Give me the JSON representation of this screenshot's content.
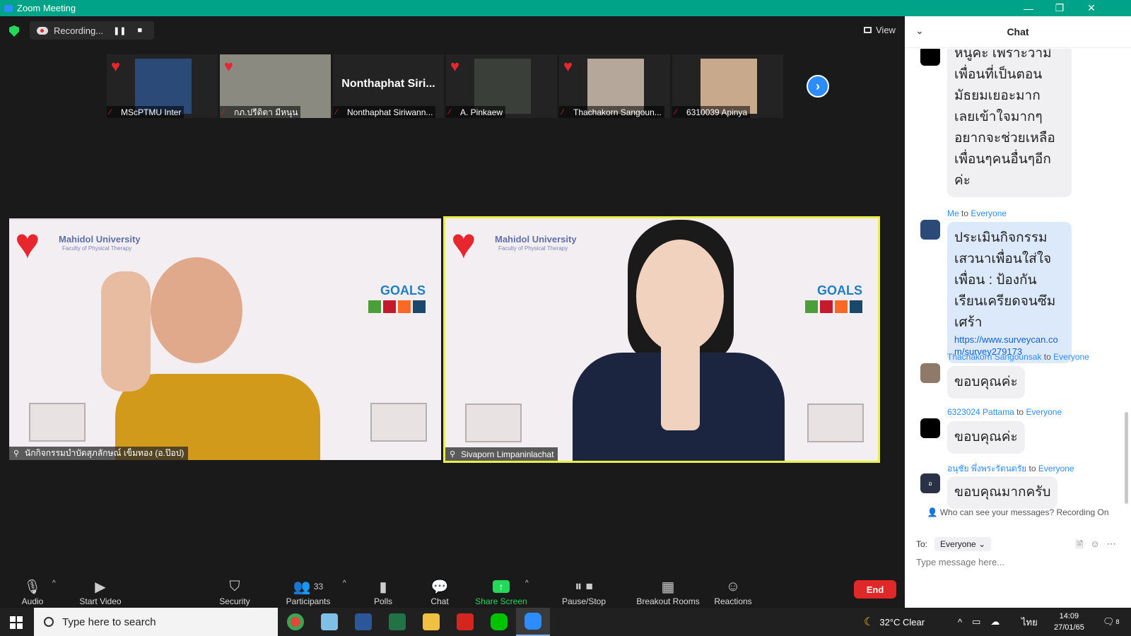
{
  "window": {
    "title": "Zoom Meeting",
    "min": "—",
    "restore": "❐",
    "close": "✕"
  },
  "meeting": {
    "recording_label": "Recording...",
    "pause_glyph": "❚❚",
    "stop_glyph": "■",
    "view_label": "View",
    "next_glyph": "›",
    "heart": "♥",
    "mic_off": "🎙"
  },
  "thumbnails": [
    {
      "name": "MScPTMU Inter",
      "pic_color": "#2b4a78"
    },
    {
      "name": "กภ.ปรีดิตา มีหนุน",
      "pic_color": "#8a8a80"
    },
    {
      "name": "Nonthaphat Siriwann...",
      "big": "Nonthaphat  Siri..."
    },
    {
      "name": "A. Pinkaew",
      "pic_color": "#3a3f3a"
    },
    {
      "name": "Thachakorn Sangoun...",
      "pic_color": "#b5a89a"
    },
    {
      "name": "6310039 Apinya",
      "pic_color": "#c9a98c"
    }
  ],
  "videos": [
    {
      "label": "นักกิจกรรมบำบัดสุภลักษณ์ เข็มทอง (อ.ป๊อป)",
      "slide_title": "Mahidol University",
      "slide_sub": "Faculty of Physical Therapy",
      "goals": "GOALS",
      "person_shirt": "#d19a1a",
      "person_skin": "#e0a98c"
    },
    {
      "label": "Sivaporn Limpaninlachat",
      "slide_title": "Mahidol University",
      "slide_sub": "Faculty of Physical Therapy",
      "goals": "GOALS",
      "person_shirt": "#1b2540",
      "person_skin": "#f1d2bf"
    }
  ],
  "toolbar": {
    "audio": "Audio",
    "start_video": "Start Video",
    "security": "Security",
    "participants": "Participants",
    "participants_count": "33",
    "polls": "Polls",
    "chat": "Chat",
    "share_screen": "Share Screen",
    "pause_stop_recording": "Pause/Stop Recording",
    "breakout_rooms": "Breakout Rooms",
    "reactions": "Reactions",
    "end": "End",
    "caret": "^"
  },
  "chat": {
    "title": "Chat",
    "collapse_glyph": "⌄",
    "messages": [
      {
        "sender": "",
        "to": "",
        "recipient": "",
        "text": "หนูค่ะ เพราะว่ามีเพื่อนที่เป็นตอนมัธยมเยอะมาก เลยเข้าใจมากๆ อยากจะช่วยเหลือเพื่อนๆคนอื่นๆอีกค่ะ"
      },
      {
        "sender": "Me",
        "to": "to",
        "recipient": "Everyone",
        "text": "ประเมินกิจกรรม เสวนาเพื่อนใส่ใจเพื่อน : ป้องกันเรียนเครียดจนซึมเศร้า",
        "link": "https://www.surveycan.com/survey279173"
      },
      {
        "sender": "Thachakorn Sangounsak",
        "to": "to",
        "recipient": "Everyone",
        "text": "ขอบคุณค่ะ"
      },
      {
        "sender": "6323024 Pattama",
        "to": "to",
        "recipient": "Everyone",
        "text": "ขอบคุณค่ะ"
      },
      {
        "sender": "อนุชัย พึ่งพระรัตนตรัย",
        "to": "to",
        "recipient": "Everyone",
        "text": "ขอบคุณมากครับ",
        "avatar_letter": "อ"
      }
    ],
    "who_can_see": "Who can see your messages? Recording On",
    "to_label": "To:",
    "to_value": "Everyone",
    "placeholder": "Type message here..."
  },
  "taskbar": {
    "search_placeholder": "Type here to search",
    "weather": "32°C  Clear",
    "lang": "ไทย",
    "time": "14:09",
    "date": "27/01/65",
    "notif_count": "8",
    "apps": [
      "chrome-icon",
      "files-icon",
      "word-icon",
      "excel-icon",
      "explorer-icon",
      "acrobat-icon",
      "line-icon",
      "zoom-icon"
    ]
  }
}
